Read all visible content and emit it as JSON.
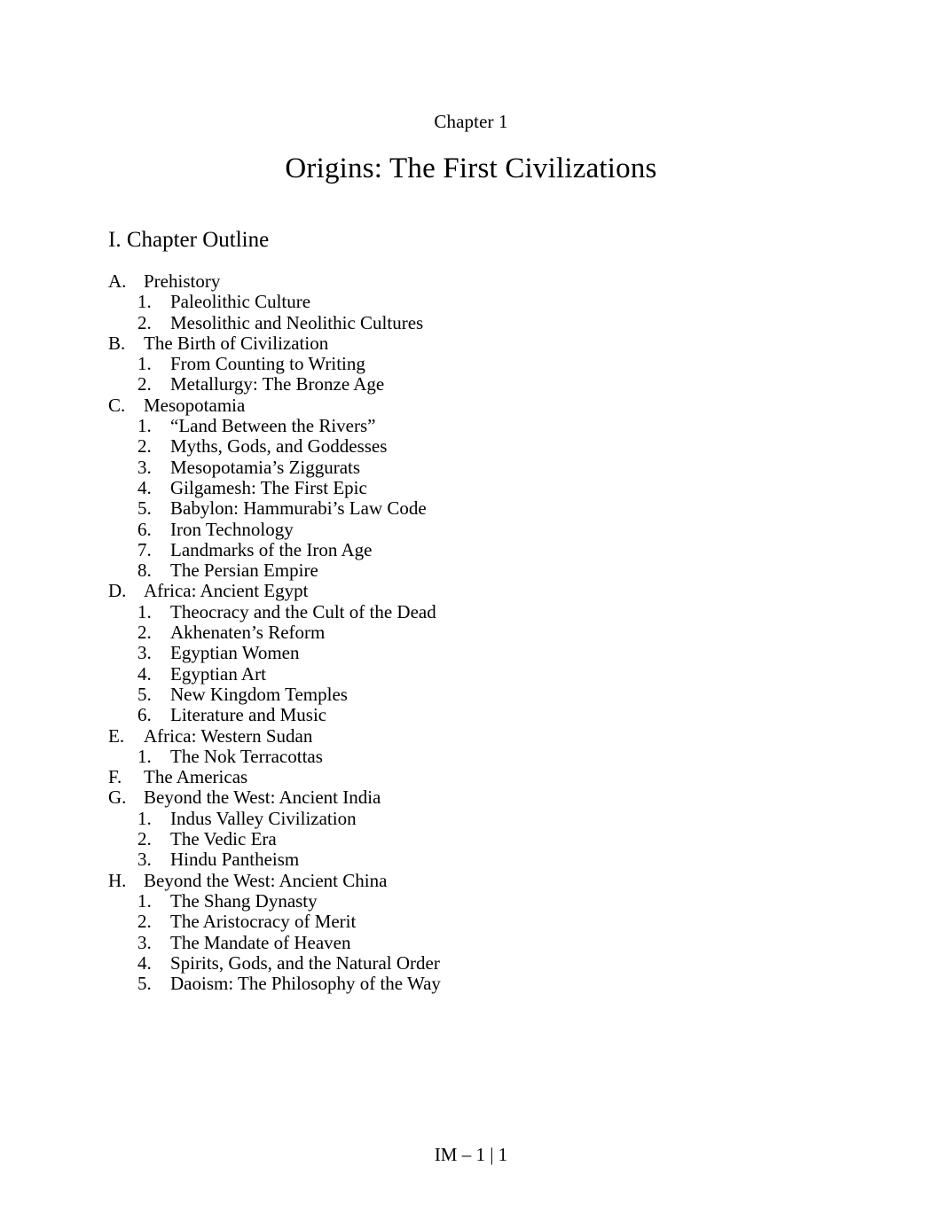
{
  "document": {
    "chapter_label": "Chapter 1",
    "title": "Origins: The First Civilizations",
    "footer": "IM – 1 | 1",
    "text_color": "#000000",
    "background_color": "#ffffff"
  },
  "section": {
    "heading": "I. Chapter Outline"
  },
  "outline": [
    {
      "marker": "A.",
      "label": "Prehistory",
      "children": [
        {
          "marker": "1.",
          "label": "Paleolithic Culture"
        },
        {
          "marker": "2.",
          "label": "Mesolithic and Neolithic Cultures"
        }
      ]
    },
    {
      "marker": "B.",
      "label": "The Birth of Civilization",
      "children": [
        {
          "marker": "1.",
          "label": "From Counting to Writing"
        },
        {
          "marker": "2.",
          "label": "Metallurgy: The Bronze Age"
        }
      ]
    },
    {
      "marker": "C.",
      "label": "Mesopotamia",
      "children": [
        {
          "marker": "1.",
          "label": "“Land Between the Rivers”"
        },
        {
          "marker": "2.",
          "label": "Myths, Gods, and Goddesses"
        },
        {
          "marker": "3.",
          "label": "Mesopotamia’s Ziggurats"
        },
        {
          "marker": "4.",
          "label": "Gilgamesh: The First Epic"
        },
        {
          "marker": "5.",
          "label": "Babylon: Hammurabi’s Law Code"
        },
        {
          "marker": "6.",
          "label": "Iron Technology"
        },
        {
          "marker": "7.",
          "label": "Landmarks of the Iron Age"
        },
        {
          "marker": "8.",
          "label": "The Persian Empire"
        }
      ]
    },
    {
      "marker": "D.",
      "label": "Africa: Ancient Egypt",
      "children": [
        {
          "marker": "1.",
          "label": "Theocracy and the Cult of the Dead"
        },
        {
          "marker": "2.",
          "label": "Akhenaten’s Reform"
        },
        {
          "marker": "3.",
          "label": "Egyptian Women"
        },
        {
          "marker": "4.",
          "label": "Egyptian Art"
        },
        {
          "marker": "5.",
          "label": "New Kingdom Temples"
        },
        {
          "marker": "6.",
          "label": "Literature and Music"
        }
      ]
    },
    {
      "marker": "E.",
      "label": "Africa: Western Sudan",
      "children": [
        {
          "marker": "1.",
          "label": "The Nok Terracottas"
        }
      ]
    },
    {
      "marker": "F.",
      "label": "The Americas",
      "children": []
    },
    {
      "marker": "G.",
      "label": "Beyond the West: Ancient India",
      "children": [
        {
          "marker": "1.",
          "label": "Indus Valley Civilization"
        },
        {
          "marker": "2.",
          "label": "The Vedic Era"
        },
        {
          "marker": "3.",
          "label": "Hindu Pantheism"
        }
      ]
    },
    {
      "marker": "H.",
      "label": "Beyond the West: Ancient China",
      "children": [
        {
          "marker": "1.",
          "label": "The Shang Dynasty"
        },
        {
          "marker": "2.",
          "label": "The Aristocracy of Merit"
        },
        {
          "marker": "3.",
          "label": "The Mandate of Heaven"
        },
        {
          "marker": "4.",
          "label": "Spirits, Gods, and the Natural Order"
        },
        {
          "marker": "5.",
          "label": "Daoism: The Philosophy of the Way"
        }
      ]
    }
  ]
}
